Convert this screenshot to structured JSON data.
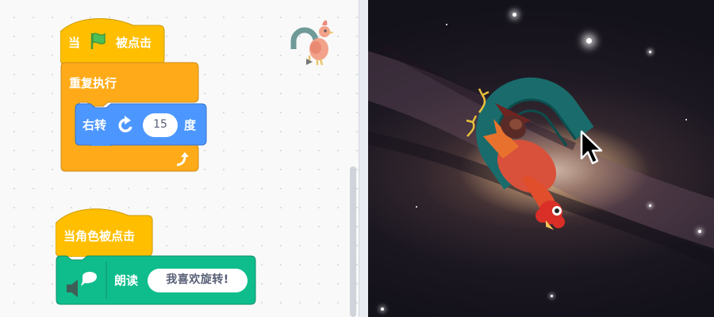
{
  "workspace": {
    "script1": {
      "hat_prefix": "当",
      "hat_suffix": "被点击",
      "repeat_label": "重复执行",
      "turn_label": "右转",
      "turn_value": "15",
      "turn_unit": "度",
      "flag_icon": "green-flag-icon",
      "rotate_icon": "rotate-right-icon",
      "loop_arrow_icon": "loop-arrow-icon"
    },
    "script2": {
      "hat_label": "当角色被点击",
      "speak_label": "朗读",
      "speak_text": "我喜欢旋转!",
      "speaker_icon": "text-to-speech-icon"
    }
  },
  "stage": {
    "sprite": "rooster",
    "background": "galaxy"
  },
  "colors": {
    "events": "#ffbf00",
    "control": "#ffab19",
    "motion": "#4c97ff",
    "extension": "#0fbd8c"
  }
}
